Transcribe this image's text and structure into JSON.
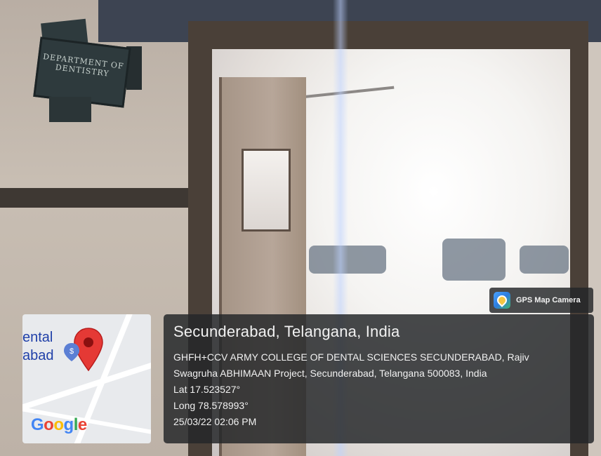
{
  "sign": {
    "text": "DEPARTMENT OF DENTISTRY"
  },
  "gps_badge": {
    "label": "GPS Map Camera",
    "icon": "gps-map-camera-icon"
  },
  "map": {
    "label_line1": "ental",
    "label_line2": "abad",
    "pin_icon": "map-pin-icon",
    "logo_letters": [
      "G",
      "o",
      "o",
      "g",
      "l",
      "e"
    ],
    "logo_colors": [
      "#4285F4",
      "#EA4335",
      "#FBBC05",
      "#4285F4",
      "#34A853",
      "#EA4335"
    ]
  },
  "location": {
    "title": "Secunderabad, Telangana, India",
    "address_line1": "GHFH+CCV ARMY COLLEGE OF DENTAL SCIENCES SECUNDERABAD, Rajiv",
    "address_line2": "Swagruha ABHIMAAN Project, Secunderabad, Telangana 500083, India",
    "lat": "Lat 17.523527°",
    "long": "Long 78.578993°",
    "datetime": "25/03/22 02:06 PM"
  }
}
